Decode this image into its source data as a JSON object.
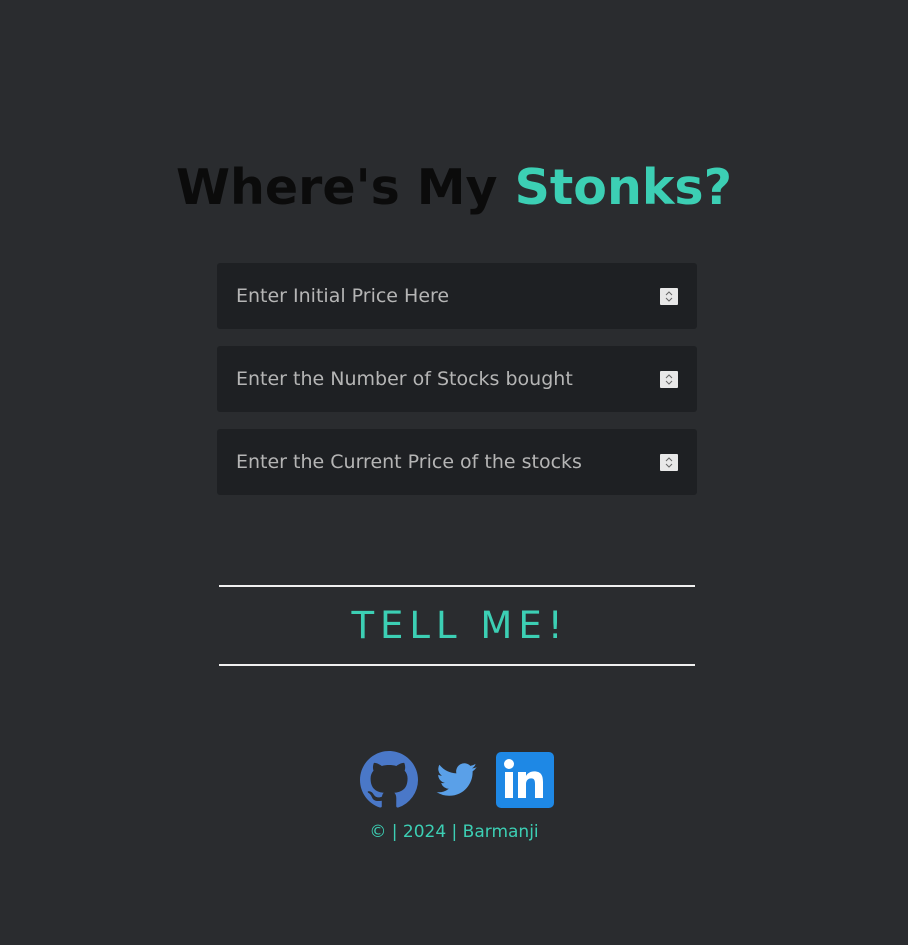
{
  "header": {
    "title_part1": "Where's My",
    "title_part2": "Stonks?"
  },
  "form": {
    "initial_price_placeholder": "Enter Initial Price Here",
    "quantity_placeholder": "Enter the Number of Stocks bought",
    "current_price_placeholder": "Enter the Current Price of the stocks",
    "submit_label": "TELL ME!"
  },
  "socials": [
    {
      "icon": "github-icon",
      "color": "#4a78c8"
    },
    {
      "icon": "twitter-icon",
      "color": "#5aa0e8"
    },
    {
      "icon": "linkedin-icon",
      "color": "#1e88e5"
    }
  ],
  "footer": {
    "text": "© | 2024 | Barmanji"
  },
  "colors": {
    "background": "#2a2c2f",
    "accent": "#3ccfb4",
    "input_bg": "#1e2023"
  }
}
